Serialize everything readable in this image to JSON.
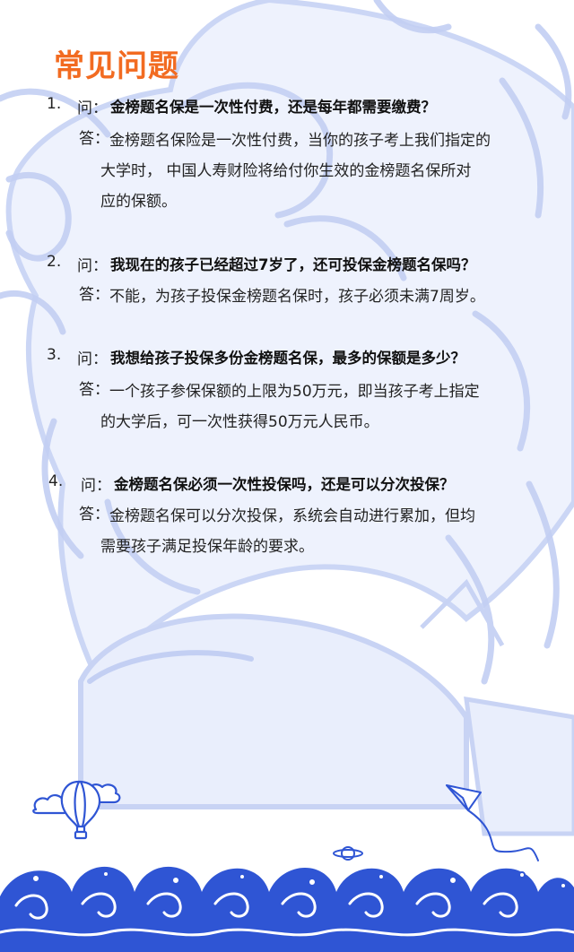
{
  "page": {
    "title": "常见问题",
    "accent_color": "#f26b21",
    "illustration_color": "#3d5fd1"
  },
  "faq": [
    {
      "number": "1.",
      "q_tag": "问：",
      "question": "金榜题名保是一次性付费，还是每年都需要缴费？",
      "a_tag": "答：",
      "answer_lines": [
        "金榜题名保险是一次性付费，当你的孩子考上我们指定的",
        "大学时，  中国人寿财险将给付你生效的金榜题名保所对",
        "应的保额。"
      ]
    },
    {
      "number": "2.",
      "q_tag": "问：",
      "question": "我现在的孩子已经超过7岁了，还可投保金榜题名保吗？",
      "a_tag": "答：",
      "answer_lines": [
        "不能，为孩子投保金榜题名保时，孩子必须未满7周岁。"
      ]
    },
    {
      "number": "3.",
      "q_tag": "问：",
      "question": "我想给孩子投保多份金榜题名保，最多的保额是多少？",
      "a_tag": "答：",
      "answer_lines": [
        "一个孩子参保保额的上限为50万元，即当孩子考上指定",
        "的大学后，可一次性获得50万元人民币。"
      ]
    },
    {
      "number": "4.",
      "q_tag": "问：",
      "question": "金榜题名保必须一次性投保吗，还是可以分次投保？",
      "a_tag": "答：",
      "answer_lines": [
        "金榜题名保可以分次投保，系统会自动进行累加，但均",
        "需要孩子满足投保年龄的要求。"
      ]
    }
  ],
  "icons": {
    "balloon": "hot-air-balloon-icon",
    "plane": "paper-plane-icon",
    "planet": "planet-icon",
    "waves": "ocean-waves-decoration"
  }
}
